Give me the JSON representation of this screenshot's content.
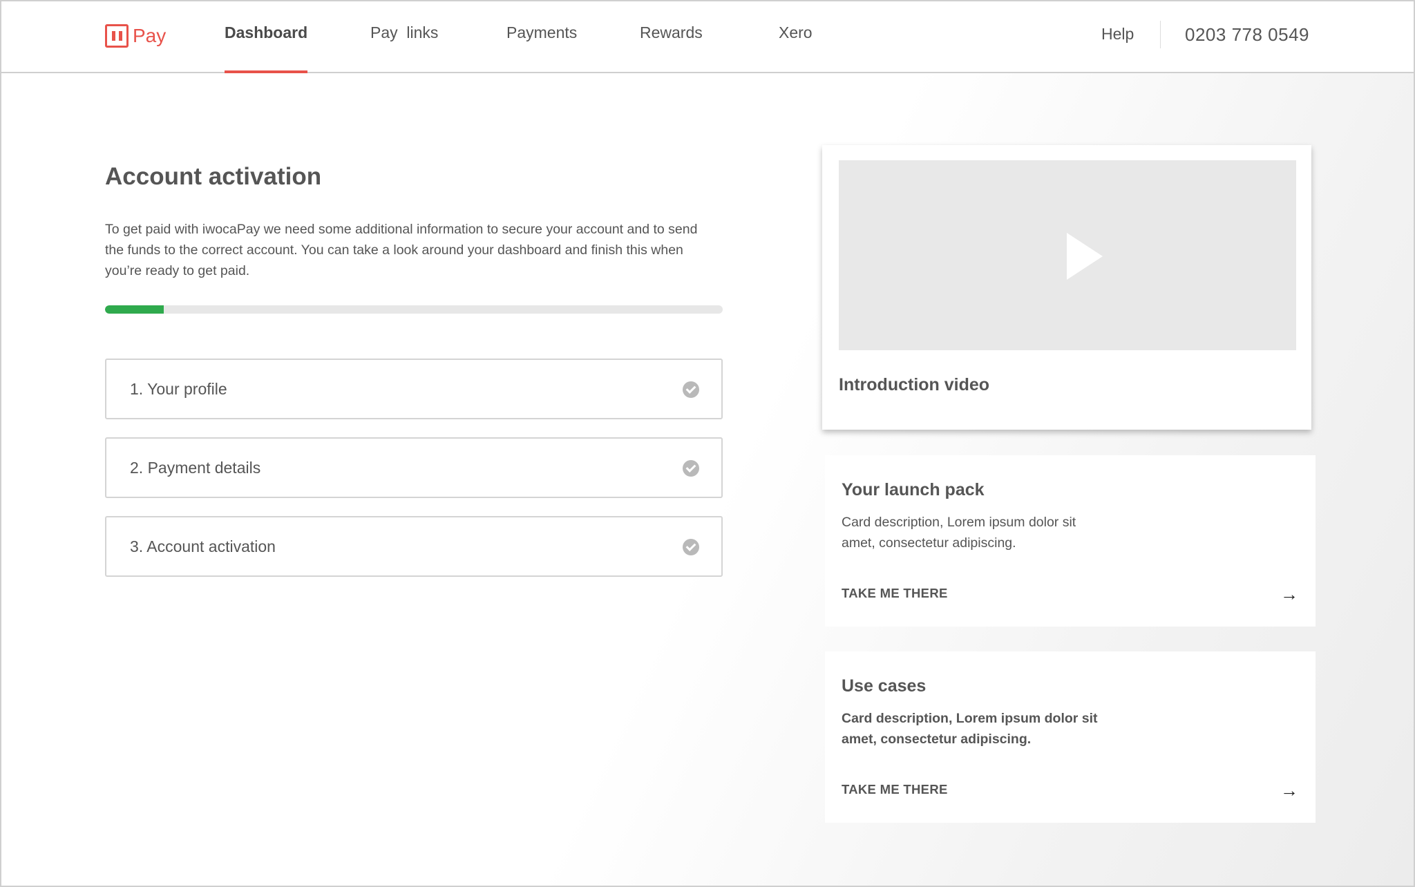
{
  "header": {
    "logo_text": "Pay",
    "nav": [
      {
        "label": "Dashboard",
        "active": true
      },
      {
        "label": "Pay  links",
        "active": false
      },
      {
        "label": "Payments",
        "active": false
      },
      {
        "label": "Rewards",
        "active": false
      },
      {
        "label": "Xero",
        "active": false
      }
    ],
    "help_label": "Help",
    "phone": "0203 778 0549"
  },
  "activation": {
    "title": "Account activation",
    "description": "To get paid with iwocaPay we need some additional information to secure your account and to send the funds to the correct account. You can take a look around your dashboard and finish this when you’re ready to get paid.",
    "progress_percent": 9.5,
    "steps": [
      {
        "label": "1. Your profile",
        "icon": "check-circle-icon"
      },
      {
        "label": "2. Payment details",
        "icon": "check-circle-icon"
      },
      {
        "label": "3. Account activation",
        "icon": "check-circle-icon"
      }
    ]
  },
  "video_card": {
    "title": "Introduction video",
    "icon": "play-icon"
  },
  "cards": [
    {
      "title": "Your launch pack",
      "description": "Card description, Lorem ipsum dolor sit amet, consectetur adipiscing.",
      "link_label": "TAKE ME THERE",
      "icon": "arrow-right-icon"
    },
    {
      "title": "Use cases",
      "description": "Card description, Lorem ipsum dolor sit amet, consectetur adipiscing.",
      "link_label": "TAKE ME THERE",
      "icon": "arrow-right-icon"
    }
  ],
  "colors": {
    "brand": "#e8524a",
    "progress": "#2faa4d",
    "check": "#b9b9b9"
  }
}
